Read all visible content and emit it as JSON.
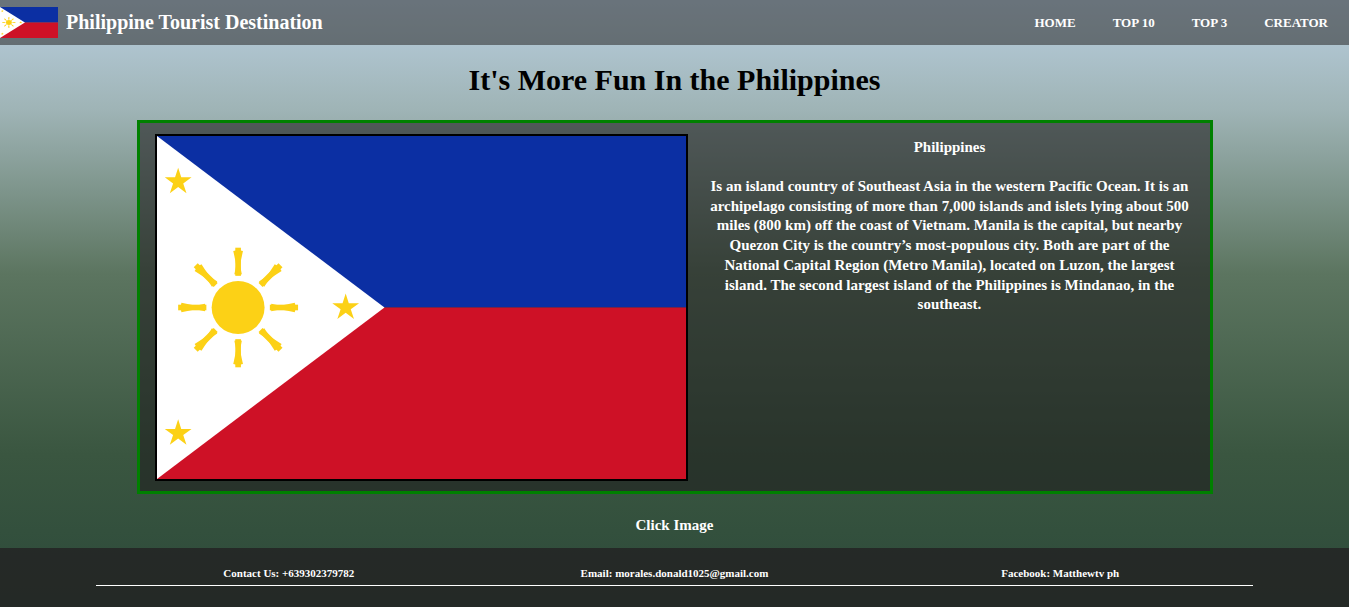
{
  "nav": {
    "title": "Philippine Tourist Destination",
    "links": [
      {
        "label": "HOME"
      },
      {
        "label": "TOP 10"
      },
      {
        "label": "TOP 3"
      },
      {
        "label": "CREATOR"
      }
    ]
  },
  "heading": "It's More Fun In the Philippines",
  "card": {
    "title": "Philippines",
    "description": "Is an island country of Southeast Asia in the western Pacific Ocean. It is an archipelago consisting of more than 7,000 islands and islets lying about 500 miles (800 km) off the coast of Vietnam. Manila is the capital, but nearby Quezon City is the country’s most-populous city. Both are part of the National Capital Region (Metro Manila), located on Luzon, the largest island. The second largest island of the Philippines is Mindanao, in the southeast."
  },
  "caption": "Click Image",
  "footer": {
    "items": [
      "Contact Us: +639302379782",
      "Email: morales.donald1025@gmail.com",
      "Facebook: Matthewtv ph"
    ]
  }
}
